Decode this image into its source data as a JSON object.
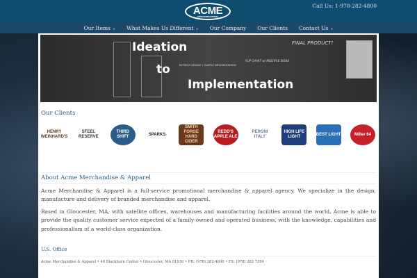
{
  "header": {
    "logo_text": "ACME",
    "logo_sub": "MERCHANDISE & APPAREL",
    "call": "Call Us: 1-978-282-4800"
  },
  "nav": [
    {
      "label": "Our Items",
      "caret": "+"
    },
    {
      "label": "What Makes Us Different",
      "caret": "+"
    },
    {
      "label": "Our Company"
    },
    {
      "label": "Our Clients"
    },
    {
      "label": "Contact Us",
      "caret": "+"
    }
  ],
  "banner": {
    "line1": "Ideation",
    "line2": "to",
    "line3": "Implementation",
    "note1": "FINAL PRODUCT!",
    "note2": "FLIP CHART w/ MULTIPLE SIGNS",
    "note3": "REFRESH DESIGN + SAMPLE IMPLEMENTATION"
  },
  "clients_title": "Our Clients",
  "clients": [
    {
      "name": "HENRY WEINHARD'S",
      "bg": "#fff",
      "fg": "#5a3a1a"
    },
    {
      "name": "STEEL RESERVE",
      "bg": "#fff",
      "fg": "#333"
    },
    {
      "name": "THIRD SHIFT",
      "bg": "#2b5c8a",
      "fg": "#fff"
    },
    {
      "name": "SPARKS",
      "bg": "#fff",
      "fg": "#222"
    },
    {
      "name": "SMITH FORGE HARD CIDER",
      "bg": "#6b3a1e",
      "fg": "#f3d9a8"
    },
    {
      "name": "REDD'S APPLE ALE",
      "bg": "#b51d22",
      "fg": "#fff"
    },
    {
      "name": "PERONI ITALY",
      "bg": "#fff",
      "fg": "#6a7890"
    },
    {
      "name": "HIGH LIFE LIGHT",
      "bg": "#1f3d7a",
      "fg": "#fff"
    },
    {
      "name": "BEST LIGHT",
      "bg": "#2a6fb5",
      "fg": "#fff"
    },
    {
      "name": "Miller 64",
      "bg": "#c8202a",
      "fg": "#fff"
    }
  ],
  "about": {
    "title": "About Acme Merchandise & Apparel",
    "p1": "Acme Merchandise & Apparel is a full-service promotional merchandise & apparel agency. We specialize in the design, manufacture and delivery of branded merchandise and apparel.",
    "p2": "Based in Gloucester, MA, with satellite offices, warehouses and manufacturing facilities around the world, Acme is able to provide the quality customer service expected of a family-owned and operated business, with the knowledge, capabilities and professionalism of a world-class organization."
  },
  "office": {
    "title": "U.S. Office",
    "address": "Acme Merchandise & Apparel • 46 Blackburn Center • Gloucester, MA 01930 • PH: (978) 282-4800 • FX: (978) 282 7300"
  }
}
